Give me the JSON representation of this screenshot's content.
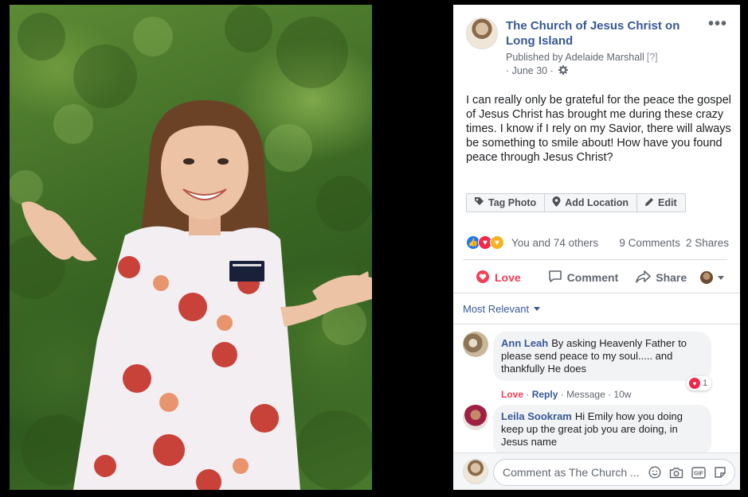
{
  "post": {
    "page_name": "The Church of Jesus Christ on Long Island",
    "published_by": "Published by Adelaide Marshall",
    "published_q": "[?]",
    "date": "· June 30 ·",
    "more": "•••",
    "text": "I can really only be grateful for the peace the gospel of Jesus Christ has brought me during these crazy times. I know if I rely on my Savior, there will always be something to smile about! How have you found peace through Jesus Christ?"
  },
  "photo_actions": {
    "tag_photo": "Tag Photo",
    "add_location": "Add Location",
    "edit": "Edit"
  },
  "reactions": {
    "summary": "You and 74 others",
    "comments_count": "9 Comments",
    "shares_count": "2 Shares"
  },
  "buttons": {
    "love": "Love",
    "comment": "Comment",
    "share": "Share"
  },
  "sort": {
    "label": "Most Relevant"
  },
  "comments": [
    {
      "author": "Ann Leah",
      "text": "By asking Heavenly Father to please send peace to my soul..... and thankfully He does",
      "love": "Love",
      "reply": "Reply",
      "message": "· Message · 10w",
      "reaction_count": "1"
    },
    {
      "author": "Leila Sookram",
      "text": "Hi Emily how you doing keep up the great job you are doing, in Jesus name"
    }
  ],
  "comment_box": {
    "placeholder": "Comment as The Church ..."
  },
  "colors": {
    "link": "#385898",
    "love": "#f33e58",
    "like": "#2078f4"
  },
  "icons": [
    "tag-icon",
    "location-icon",
    "pencil-icon",
    "gear-icon",
    "heart-icon",
    "comment-icon",
    "share-icon",
    "emoji-icon",
    "camera-icon",
    "gif-icon",
    "sticker-icon"
  ]
}
